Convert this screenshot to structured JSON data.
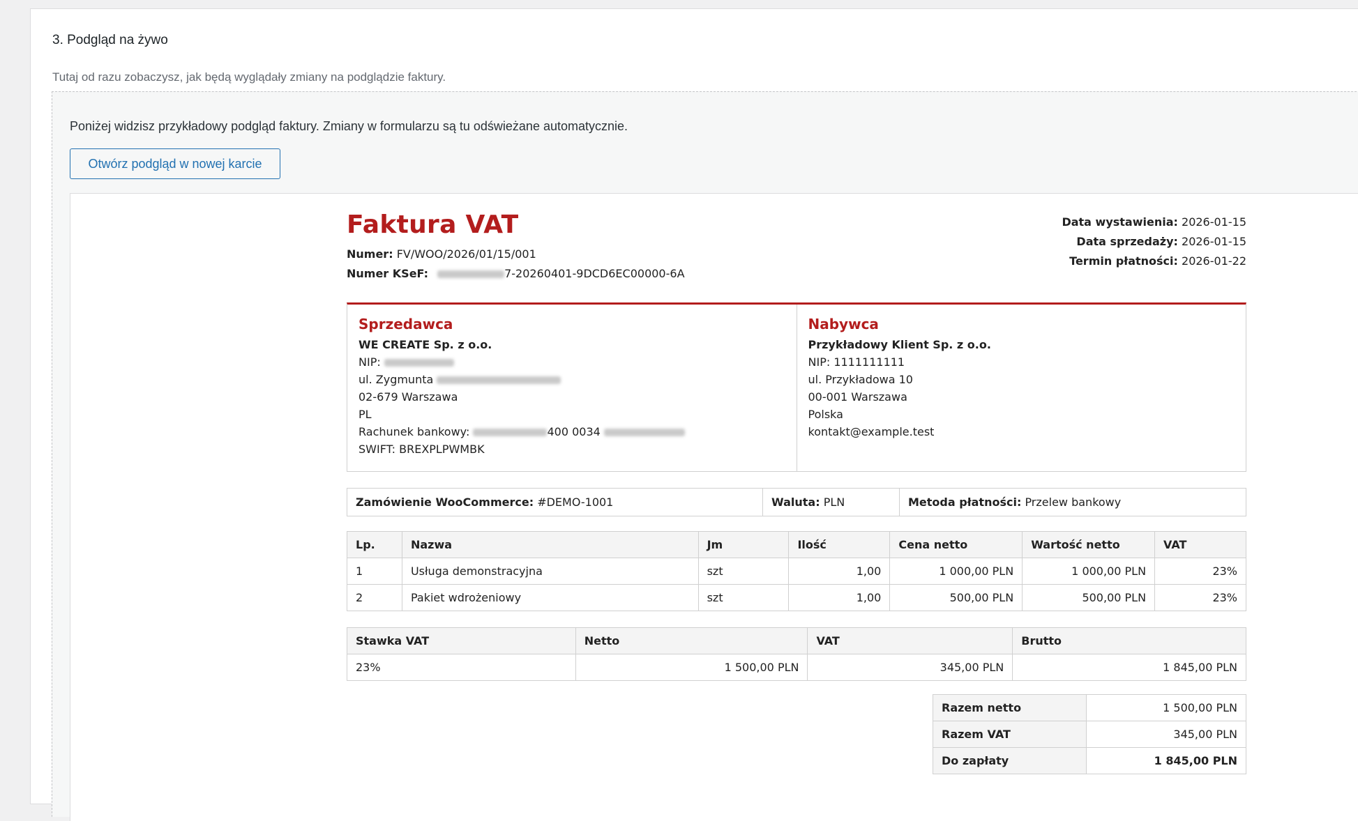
{
  "section": {
    "title": "3. Podgląd na żywo",
    "description": "Tutaj od razu zobaczysz, jak będą wyglądały zmiany na podglądzie faktury."
  },
  "preview": {
    "intro": "Poniżej widzisz przykładowy podgląd faktury. Zmiany w formularzu są tu odświeżane automatycznie.",
    "open_button": "Otwórz podgląd w nowej karcie"
  },
  "invoice": {
    "title": "Faktura VAT",
    "number_label": "Numer:",
    "number": "FV/WOO/2026/01/15/001",
    "ksef_label": "Numer KSeF:",
    "ksef_suffix": "7-20260401-9DCD6EC00000-6A",
    "dates": {
      "issue_label": "Data wystawienia:",
      "issue": "2026-01-15",
      "sale_label": "Data sprzedaży:",
      "sale": "2026-01-15",
      "due_label": "Termin płatności:",
      "due": "2026-01-22"
    },
    "seller": {
      "heading": "Sprzedawca",
      "name": "WE CREATE Sp. z o.o.",
      "nip_label": "NIP:",
      "street": "ul. Zygmunta",
      "city": "02-679 Warszawa",
      "country": "PL",
      "bank_label": "Rachunek bankowy:",
      "bank_visible": "400 0034",
      "swift": "SWIFT: BREXPLPWMBK"
    },
    "buyer": {
      "heading": "Nabywca",
      "name": "Przykładowy Klient Sp. z o.o.",
      "nip": "NIP: 1111111111",
      "street": "ul. Przykładowa 10",
      "city": "00-001 Warszawa",
      "country": "Polska",
      "email": "kontakt@example.test"
    },
    "order": {
      "order_label": "Zamówienie WooCommerce:",
      "order_value": "#DEMO-1001",
      "currency_label": "Waluta:",
      "currency_value": "PLN",
      "payment_label": "Metoda płatności:",
      "payment_value": "Przelew bankowy"
    },
    "items": {
      "headers": [
        "Lp.",
        "Nazwa",
        "Jm",
        "Ilość",
        "Cena netto",
        "Wartość netto",
        "VAT"
      ],
      "rows": [
        [
          "1",
          "Usługa demonstracyjna",
          "szt",
          "1,00",
          "1 000,00 PLN",
          "1 000,00 PLN",
          "23%"
        ],
        [
          "2",
          "Pakiet wdrożeniowy",
          "szt",
          "1,00",
          "500,00 PLN",
          "500,00 PLN",
          "23%"
        ]
      ]
    },
    "vat_summary": {
      "headers": [
        "Stawka VAT",
        "Netto",
        "VAT",
        "Brutto"
      ],
      "rows": [
        [
          "23%",
          "1 500,00 PLN",
          "345,00 PLN",
          "1 845,00 PLN"
        ]
      ]
    },
    "totals": [
      {
        "label": "Razem netto",
        "value": "1 500,00 PLN"
      },
      {
        "label": "Razem VAT",
        "value": "345,00 PLN"
      },
      {
        "label": "Do zapłaty",
        "value": "1 845,00 PLN"
      }
    ]
  },
  "colors": {
    "accent_red": "#b31d1d",
    "link_blue": "#2271b1"
  }
}
